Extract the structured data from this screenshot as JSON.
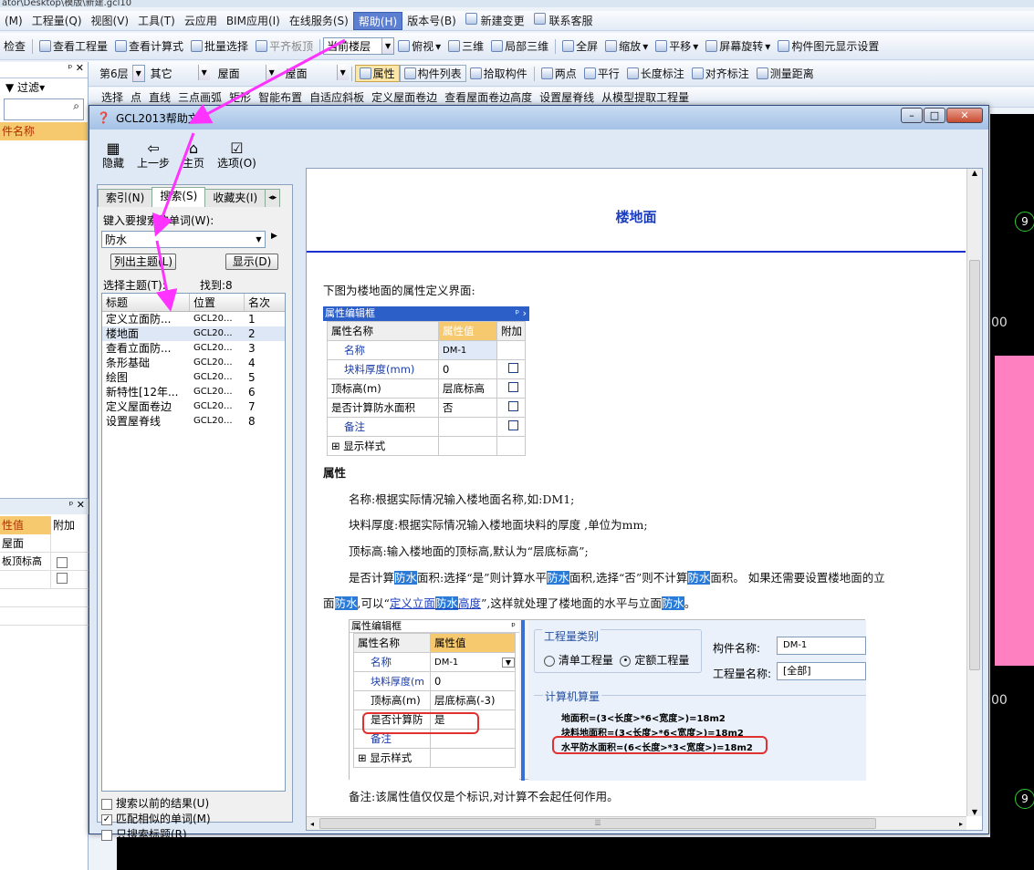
{
  "title_strip": "ator\\Desktop\\模版\\新建.gcl10",
  "menu": [
    "(M)",
    "工程量(Q)",
    "视图(V)",
    "工具(T)",
    "云应用",
    "BIM应用(I)",
    "在线服务(S)",
    "帮助(H)",
    "版本号(B)",
    "新建变更",
    "联系客服"
  ],
  "toolbar1": [
    "检查",
    "查看工程量",
    "查看计算式",
    "批量选择",
    "平齐板顶",
    "当前楼层",
    "俯视",
    "三维",
    "局部三维",
    "全屏",
    "缩放",
    "平移",
    "屏幕旋转",
    "构件图元显示设置"
  ],
  "toolbar2": {
    "floor": "第6层",
    "type": "其它",
    "c1": "屋面",
    "c2": "屋面",
    "items": [
      "属性",
      "构件列表",
      "拾取构件",
      "两点",
      "平行",
      "长度标注",
      "对齐标注",
      "测量距离"
    ]
  },
  "toolbar3": [
    "选择",
    "点",
    "直线",
    "三点画弧",
    "矩形",
    "智能布置",
    "自适应斜板",
    "定义屋面卷边",
    "查看屋面卷边高度",
    "设置屋脊线",
    "从模型提取工程量"
  ],
  "left": {
    "filter": "过滤",
    "header": "件名称",
    "prop_hdr1": "性值",
    "prop_hdr2": "附加",
    "rows": [
      "屋面",
      "板顶标高"
    ]
  },
  "cad_labels": [
    "9",
    "00",
    "00",
    "9"
  ],
  "help": {
    "title": "GCL2013帮助文档",
    "tools": [
      {
        "g": "▦",
        "label": "隐藏"
      },
      {
        "g": "⇦",
        "label": "上一步"
      },
      {
        "g": "⌂",
        "label": "主页"
      },
      {
        "g": "☑",
        "label": "选项(O)"
      }
    ],
    "tabs": [
      "索引(N)",
      "搜索(S)",
      "收藏夹(I)"
    ],
    "search_label": "键入要搜索的单词(W):",
    "search_value": "防水",
    "list_btn": "列出主题(L)",
    "show_btn": "显示(D)",
    "topic_label": "选择主题(T):",
    "found": "找到:8",
    "cols": [
      "标题",
      "位置",
      "名次"
    ],
    "results": [
      {
        "t": "定义立面防...",
        "p": "GCL20...",
        "n": "1"
      },
      {
        "t": "楼地面",
        "p": "GCL20...",
        "n": "2"
      },
      {
        "t": "查看立面防...",
        "p": "GCL20...",
        "n": "3"
      },
      {
        "t": "条形基础",
        "p": "GCL20...",
        "n": "4"
      },
      {
        "t": "绘图",
        "p": "GCL20...",
        "n": "5"
      },
      {
        "t": "新特性[12年...",
        "p": "GCL20...",
        "n": "6"
      },
      {
        "t": "定义屋面卷边",
        "p": "GCL20...",
        "n": "7"
      },
      {
        "t": "设置屋脊线",
        "p": "GCL20...",
        "n": "8"
      }
    ],
    "opt1": "搜索以前的结果(U)",
    "opt2": "匹配相似的单词(M)",
    "opt3": "只搜索标题(R)",
    "heading": "楼地面",
    "intro": "下图为楼地面的属性定义界面:",
    "pe_title": "属性编辑框",
    "pe_cols": [
      "属性名称",
      "属性值",
      "附加"
    ],
    "pe_rows": [
      {
        "n": "名称",
        "v": "DM-1"
      },
      {
        "n": "块料厚度(mm)",
        "v": "0"
      },
      {
        "n": "顶标高(m)",
        "v": "层底标高"
      },
      {
        "n": "是否计算防水面积",
        "v": "否"
      },
      {
        "n": "备注",
        "v": ""
      }
    ],
    "pe_expand": "显示样式",
    "sec": "属性",
    "p1": "名称:根据实际情况输入楼地面名称,如:DM1;",
    "p2": "块料厚度:根据实际情况输入楼地面块料的厚度 ,单位为mm;",
    "p3": "顶标高:输入楼地面的顶标高,默认为“层底标高”;",
    "p4a": "是否计算",
    "w": "防水",
    "p4b": "面积:选择“是”则计算水平",
    "p4c": "面积,选择“否”则不计算",
    "p4d": "面积。 如果还需要设置楼地面的立",
    "p5a": "面",
    "p5b": ",可以“",
    "link_a": "定义立面",
    "link_b": "高度",
    "p5c": "”,这样就处理了楼地面的水平与立面",
    "p5d": "。",
    "pe2_rows": [
      {
        "n": "名称",
        "v": "DM-1"
      },
      {
        "n": "块料厚度(m",
        "v": "0"
      },
      {
        "n": "顶标高(m)",
        "v": "层底标高(-3)"
      },
      {
        "n": "是否计算防",
        "v": "是"
      },
      {
        "n": "备注",
        "v": ""
      }
    ],
    "qty_type": "工程量类别",
    "r1": "清单工程量",
    "r2": "定额工程量",
    "comp_name_lbl": "构件名称:",
    "comp_name": "DM-1",
    "qty_name_lbl": "工程量名称:",
    "qty_name": "[全部]",
    "calc_lbl": "计算机算量",
    "f1": "地面积=(3<长度>*6<宽度>)=18m2",
    "f2": "块料地面积=(3<长度>*6<宽度>)=18m2",
    "f3": "水平防水面积=(6<长度>*3<宽度>)=18m2",
    "note": "备注:该属性值仅仅是个标识,对计算不会起任何作用。"
  },
  "colors": {
    "annotation": "#ff33ff",
    "link": "#1a3cc0",
    "highlight": "#2a7ad8",
    "heading_rule": "#1a2fd0",
    "accent": "#e03030"
  }
}
